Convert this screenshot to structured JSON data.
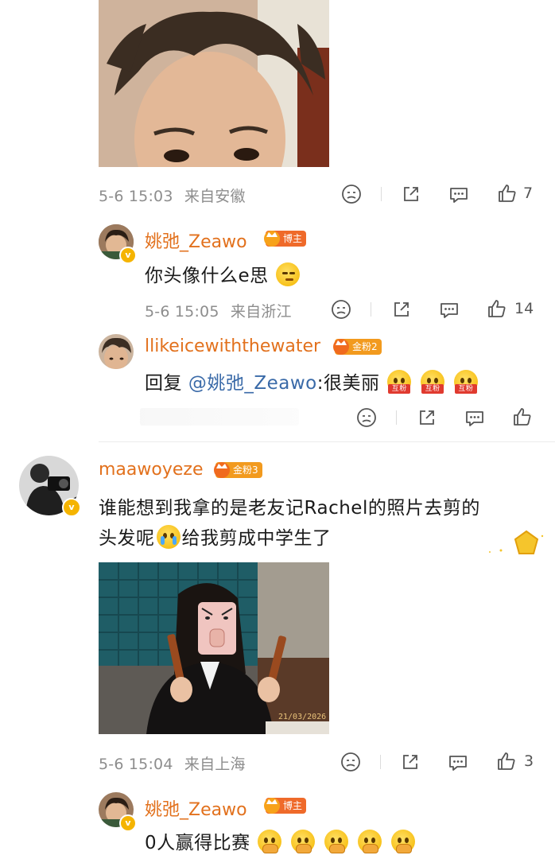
{
  "comments": [
    {
      "id": "c1",
      "time": "5-6 15:03",
      "location": "来自安徽",
      "likes": "7",
      "replies": [
        {
          "username": "姚弛_Zeawo",
          "badge": "博主",
          "text": "你头像什么e思",
          "time": "5-6 15:05",
          "location": "来自浙江",
          "likes": "14"
        },
        {
          "username": "llikeicewiththewater",
          "badge": "金粉2",
          "reply_prefix": "回复",
          "reply_target": "@姚弛_Zeawo",
          "text": ":很美丽",
          "emoji_label": "互粉"
        }
      ]
    },
    {
      "id": "c2",
      "username": "maawoyeze",
      "badge": "金粉3",
      "text_line1": "谁能想到我拿的是老友记Rachel的照片去剪的",
      "text_line2_a": "头发呢",
      "text_line2_b": "给我剪成中学生了",
      "photo_date": "21/03/2026",
      "time": "5-6 15:04",
      "location": "来自上海",
      "likes": "3",
      "replies": [
        {
          "username": "姚弛_Zeawo",
          "badge": "博主",
          "text": "0人赢得比赛"
        }
      ]
    }
  ],
  "colors": {
    "username": "#e2711d",
    "link": "#3a6aa8",
    "meta": "#8d8d8d",
    "badge_host": "#ef6a2a",
    "badge_fan": "#f29a1e"
  },
  "icons": [
    "dislike-icon",
    "share-icon",
    "comment-icon",
    "like-icon"
  ]
}
